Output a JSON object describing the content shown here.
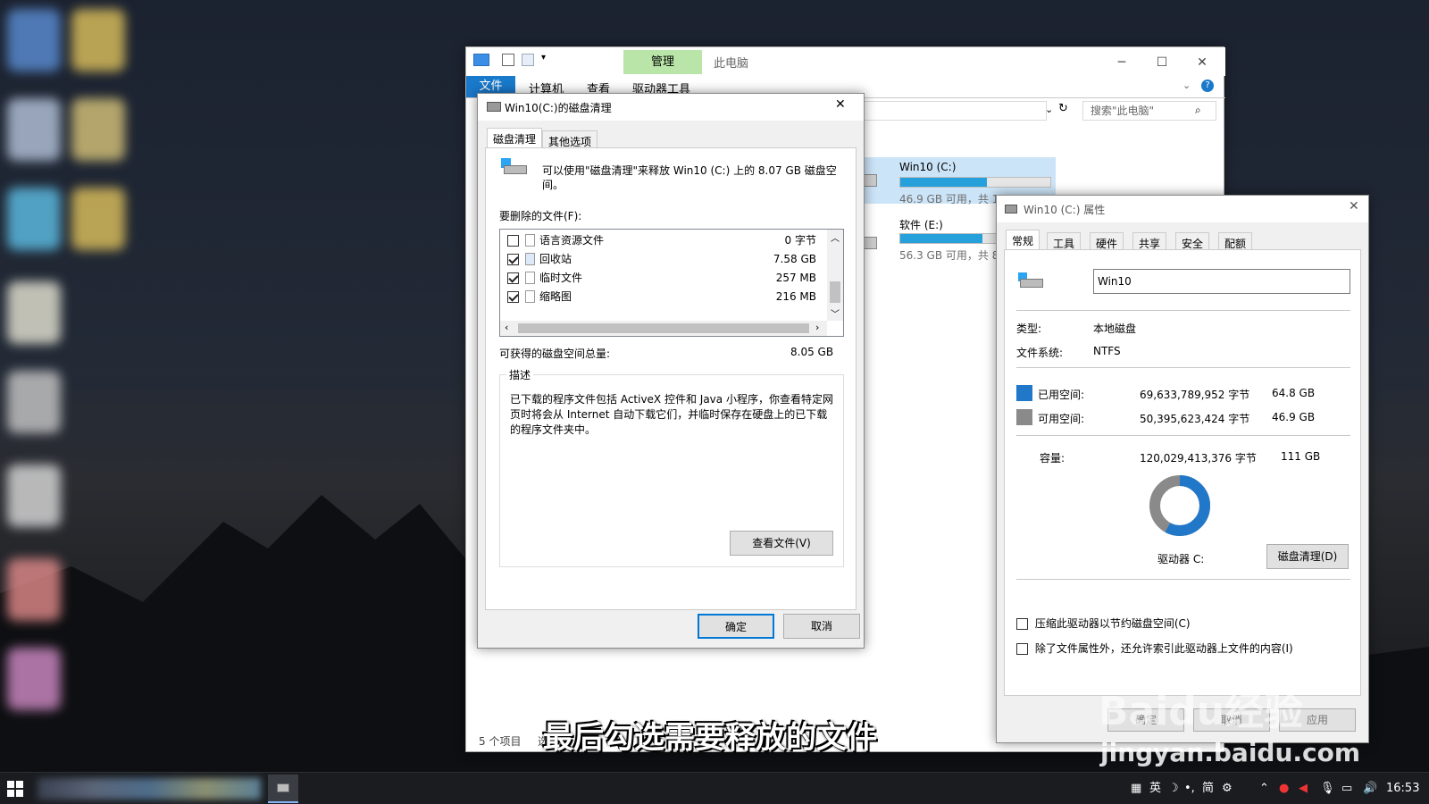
{
  "explorer": {
    "manage_tab": "管理",
    "title": "此电脑",
    "ribbon_tabs": [
      "文件",
      "计算机",
      "查看",
      "驱动器工具"
    ],
    "search_placeholder": "搜索\"此电脑\"",
    "drives": [
      {
        "name": "Win10 (C:)",
        "free": "46.9 GB 可用，共 1",
        "fill": 0.58
      },
      {
        "name": "软件 (E:)",
        "free": "56.3 GB 可用，共 8",
        "fill": 0.55
      }
    ],
    "status_items": "5 个项目",
    "status_more": "选"
  },
  "cleanup": {
    "title": "Win10(C:)的磁盘清理",
    "tabs": [
      "磁盘清理",
      "其他选项"
    ],
    "intro": "可以使用\"磁盘清理\"来释放 Win10 (C:) 上的 8.07 GB 磁盘空间。",
    "files_label": "要删除的文件(F):",
    "files": [
      {
        "name": "语言资源文件",
        "size": "0 字节",
        "checked": false
      },
      {
        "name": "回收站",
        "size": "7.58 GB",
        "checked": true
      },
      {
        "name": "临时文件",
        "size": "257 MB",
        "checked": true
      },
      {
        "name": "缩略图",
        "size": "216 MB",
        "checked": true
      }
    ],
    "total_label": "可获得的磁盘空间总量:",
    "total_value": "8.05 GB",
    "desc_label": "描述",
    "desc_text": "已下载的程序文件包括 ActiveX 控件和 Java 小程序，你查看特定网页时将会从 Internet 自动下载它们，并临时保存在硬盘上的已下载的程序文件夹中。",
    "view_files": "查看文件(V)",
    "ok": "确定",
    "cancel": "取消"
  },
  "props": {
    "title": "Win10 (C:) 属性",
    "tabs": [
      "常规",
      "工具",
      "硬件",
      "共享",
      "安全",
      "配额"
    ],
    "name_value": "Win10",
    "type_label": "类型:",
    "type_value": "本地磁盘",
    "fs_label": "文件系统:",
    "fs_value": "NTFS",
    "used_label": "已用空间:",
    "used_bytes": "69,633,789,952 字节",
    "used_gb": "64.8 GB",
    "free_label": "可用空间:",
    "free_bytes": "50,395,623,424 字节",
    "free_gb": "46.9 GB",
    "cap_label": "容量:",
    "cap_bytes": "120,029,413,376 字节",
    "cap_gb": "111 GB",
    "used_fraction": 0.58,
    "drive_label": "驱动器 C:",
    "cleanup_btn": "磁盘清理(D)",
    "compress": "压缩此驱动器以节约磁盘空间(C)",
    "index": "除了文件属性外，还允许索引此驱动器上文件的内容(I)",
    "ok": "确定",
    "cancel": "取消",
    "apply": "应用",
    "used_color": "#2177c8",
    "free_color": "#8a8a8a"
  },
  "subtitle": "最后勾选需要释放的文件",
  "watermark": {
    "logo": "Baidu经验",
    "url": "jingyan.baidu.com"
  },
  "taskbar": {
    "ime": "英",
    "ime2": "简",
    "time": "16:53"
  }
}
